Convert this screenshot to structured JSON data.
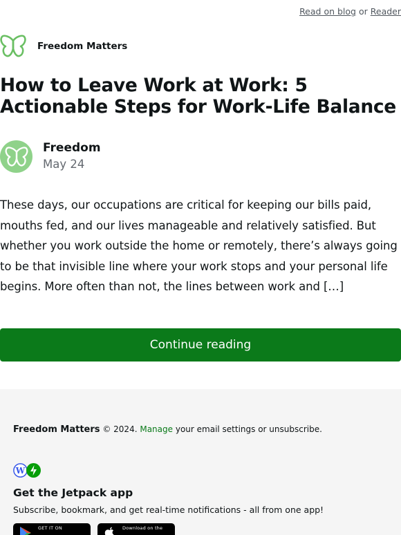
{
  "topbar": {
    "read_on_blog": "Read on blog",
    "separator": "or",
    "reader": "Reader"
  },
  "site": {
    "name": "Freedom Matters",
    "logo_icon": "butterfly-icon",
    "accent": "#6abf63"
  },
  "post": {
    "title": "How to Leave Work at Work: 5 Actionable Steps for Work-Life Balance",
    "author": "Freedom",
    "date": "May 24",
    "excerpt": "These days, our occupations are critical for keeping our bills paid, mouths fed, and our lives manageable and relatively satisfied. But whether you work outside the home or remotely, there’s always going to be that invisible line where your work stops and your personal life begins. More often than not, the lines between work and […]",
    "cta": "Continue reading",
    "cta_color": "#0b7a1a"
  },
  "footer": {
    "brand": "Freedom Matters",
    "copyright": "© 2024.",
    "manage": "Manage",
    "settings_text": "your email settings or unsubscribe.",
    "app_title": "Get the Jetpack app",
    "app_sub": "Subscribe, bookmark, and get real-time notifications - all from one app!",
    "badges": {
      "google": "GET IT ON",
      "apple": "Download on the"
    },
    "background": "#f5f5f5"
  }
}
